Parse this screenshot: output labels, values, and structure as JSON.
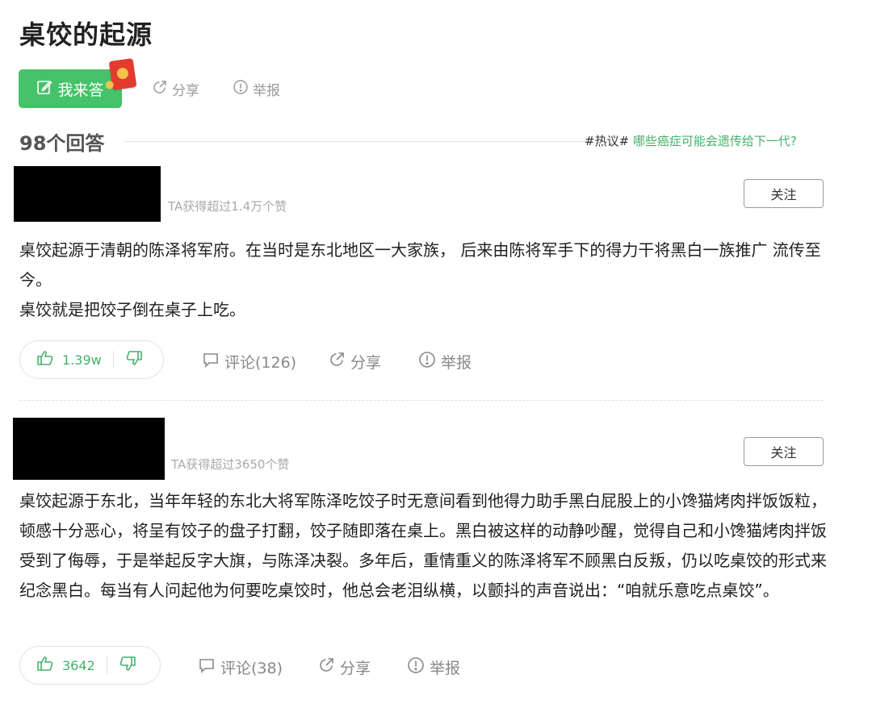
{
  "question": {
    "title": "桌饺的起源",
    "answer_button_label": "我来答",
    "share_label": "分享",
    "report_label": "举报"
  },
  "answers_header": {
    "count_label": "98个回答",
    "hot_tag": "#热议#",
    "hot_link": "哪些癌症可能会遗传给下一代?"
  },
  "answers": [
    {
      "praise_text": "TA获得超过1.4万个赞",
      "follow_label": "关注",
      "paragraphs": [
        "桌饺起源于清朝的陈泽将军府。在当时是东北地区一大家族，  后来由陈将军手下的得力干将黑白一族推广 流传至今。",
        "桌饺就是把饺子倒在桌子上吃。"
      ],
      "likes": "1.39w",
      "comment_label": "评论(126)",
      "share_label": "分享",
      "report_label": "举报"
    },
    {
      "praise_text": "TA获得超过3650个赞",
      "follow_label": "关注",
      "paragraphs": [
        "桌饺起源于东北，当年年轻的东北大将军陈泽吃饺子时无意间看到他得力助手黑白屁股上的小馋猫烤肉拌饭饭粒，顿感十分恶心，将呈有饺子的盘子打翻，饺子随即落在桌上。黑白被这样的动静吵醒，觉得自己和小馋猫烤肉拌饭受到了侮辱，于是举起反字大旗，与陈泽决裂。多年后，重情重义的陈泽将军不顾黑白反叛，仍以吃桌饺的形式来纪念黑白。每当有人问起他为何要吃桌饺时，他总会老泪纵横，以颤抖的声音说出：“咱就乐意吃点桌饺”。"
      ],
      "likes": "3642",
      "comment_label": "评论(38)",
      "share_label": "分享",
      "report_label": "举报"
    }
  ],
  "colors": {
    "accent_green": "#46c36a",
    "link_green": "#46b06a",
    "muted_gray": "#9a9a9a",
    "red_packet": "#e23b2e"
  },
  "icons": [
    "edit-icon",
    "share-icon",
    "report-icon",
    "thumb-up-icon",
    "thumb-down-icon",
    "comment-icon",
    "red-packet-icon"
  ]
}
